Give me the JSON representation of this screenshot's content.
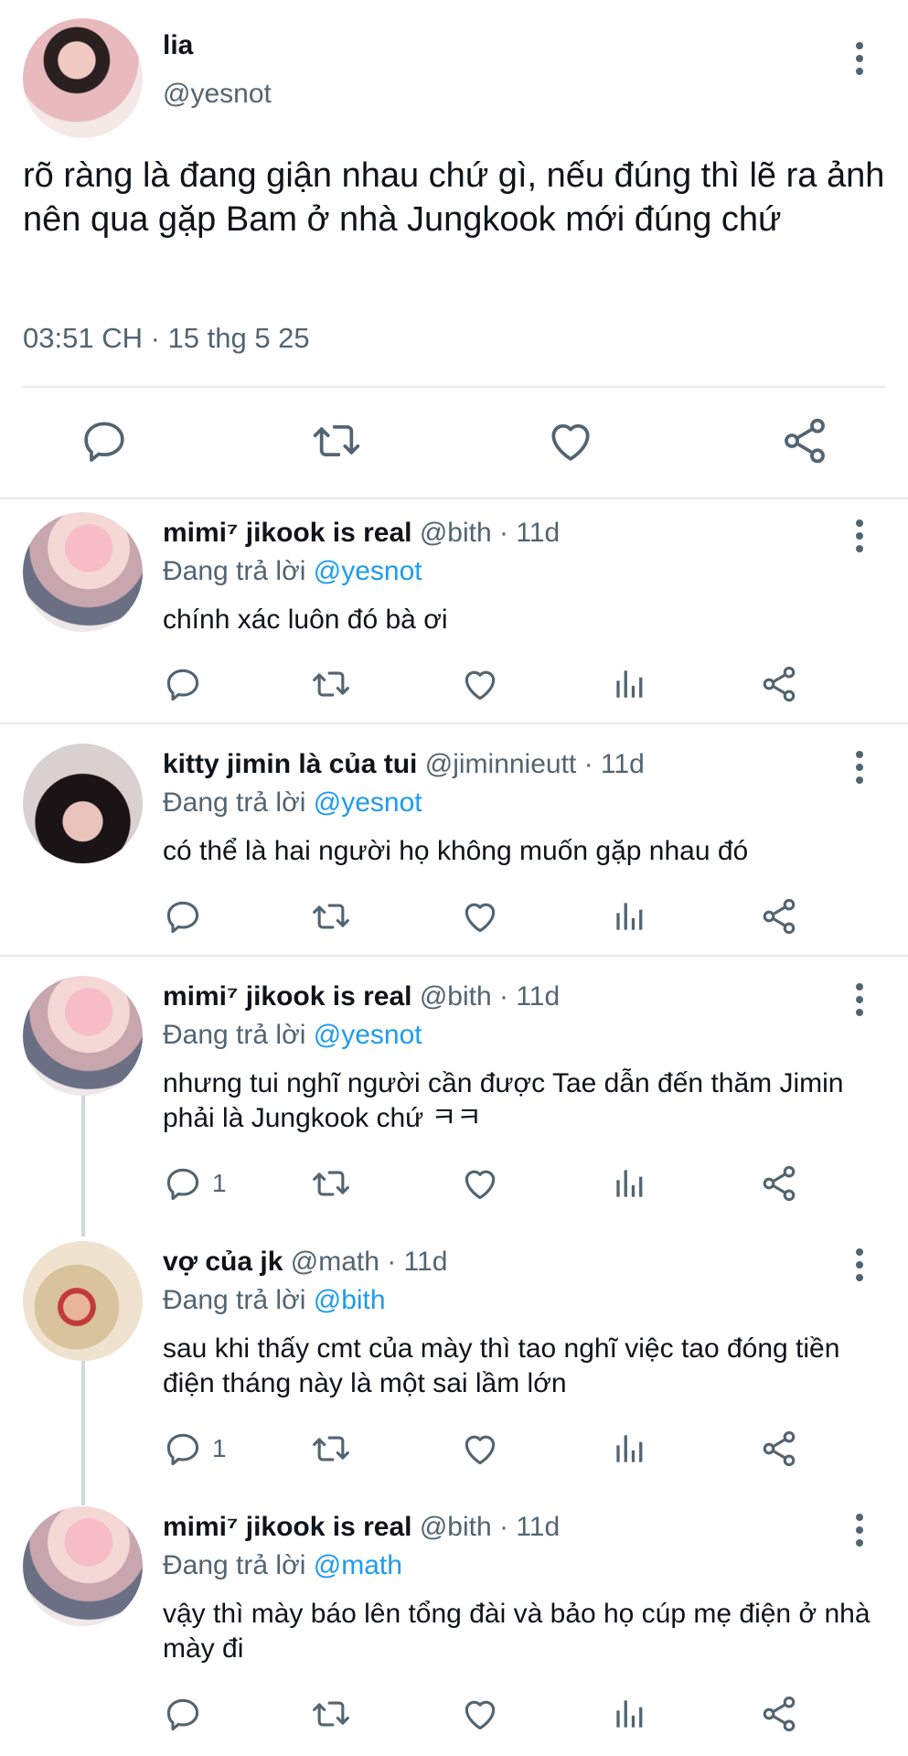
{
  "main_tweet": {
    "display_name": "lia",
    "handle": "@yesnot",
    "text": "rõ ràng là đang giận nhau chứ gì, nếu đúng thì lẽ ra ảnh nên qua gặp Bam ở nhà Jungkook mới đúng chứ",
    "timestamp": "03:51 CH · 15 thg 5 25"
  },
  "replies": [
    {
      "display_name": "mimi⁷ jikook is real",
      "meta": "@bith · 11d",
      "replying_prefix": "Đang trả lời",
      "replying_to": "@yesnot",
      "text": "chính xác luôn đó bà ơi",
      "reply_count": ""
    },
    {
      "display_name": "kitty jimin là của tui",
      "meta": "@jiminnieutt · 11d",
      "replying_prefix": "Đang trả lời",
      "replying_to": "@yesnot",
      "text": "có thể là hai người họ không muốn gặp nhau đó",
      "reply_count": ""
    },
    {
      "display_name": "mimi⁷ jikook is real",
      "meta": "@bith · 11d",
      "replying_prefix": "Đang trả lời",
      "replying_to": "@yesnot",
      "text": "nhưng tui nghĩ người cần được Tae dẫn đến thăm Jimin phải là Jungkook chứ ㅋㅋ",
      "reply_count": "1"
    },
    {
      "display_name": "vợ của jk",
      "meta": "@math · 11d",
      "replying_prefix": "Đang trả lời",
      "replying_to": "@bith",
      "text": "sau khi thấy cmt của mày thì tao nghĩ việc tao đóng tiền điện tháng này là một sai lầm lớn",
      "reply_count": "1"
    },
    {
      "display_name": "mimi⁷ jikook is real",
      "meta": "@bith · 11d",
      "replying_prefix": "Đang trả lời",
      "replying_to": "@math",
      "text": "vậy thì mày báo lên tổng đài và bảo họ cúp mẹ điện ở nhà mày đi",
      "reply_count": ""
    }
  ],
  "icons": {
    "reply": "reply-icon",
    "retweet": "retweet-icon",
    "like": "heart-icon",
    "views": "views-icon",
    "share": "share-icon",
    "more": "more-vertical-icon"
  },
  "colors": {
    "mention": "#1d9bf0",
    "secondary_text": "#536471",
    "icon": "#536471",
    "divider": "#e7e9ea"
  }
}
